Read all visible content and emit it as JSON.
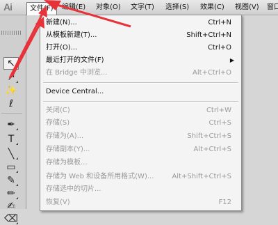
{
  "app": {
    "logo_text": "Ai"
  },
  "menubar": {
    "items": [
      "文件(F)",
      "编辑(E)",
      "对象(O)",
      "文字(T)",
      "选择(S)",
      "效果(C)",
      "视图(V)",
      "窗口"
    ]
  },
  "file_menu": {
    "items": [
      {
        "label": "新建(N)...",
        "shortcut": "Ctrl+N"
      },
      {
        "label": "从模板新建(T)...",
        "shortcut": "Shift+Ctrl+N"
      },
      {
        "label": "打开(O)...",
        "shortcut": "Ctrl+O"
      },
      {
        "label": "最近打开的文件(F)",
        "shortcut": ""
      },
      {
        "label": "在 Bridge 中浏览...",
        "shortcut": "Alt+Ctrl+O"
      },
      {
        "label": "Device Central...",
        "shortcut": ""
      },
      {
        "label": "关闭(C)",
        "shortcut": "Ctrl+W"
      },
      {
        "label": "存储(S)",
        "shortcut": "Ctrl+S"
      },
      {
        "label": "存储为(A)...",
        "shortcut": "Shift+Ctrl+S"
      },
      {
        "label": "存储副本(Y)...",
        "shortcut": "Alt+Ctrl+S"
      },
      {
        "label": "存储为模板...",
        "shortcut": ""
      },
      {
        "label": "存储为 Web 和设备所用格式(W)...",
        "shortcut": "Alt+Shift+Ctrl+S"
      },
      {
        "label": "存储选中的切片...",
        "shortcut": ""
      },
      {
        "label": "恢复(V)",
        "shortcut": "F12"
      }
    ]
  },
  "colors": {
    "annotation_arrow": "#e8323a",
    "menu_bg": "#f4f4f4",
    "disabled_text": "#9a9a9a"
  },
  "toolbox": {
    "tools": [
      "selection-tool",
      "direct-selection-tool",
      "magic-wand-tool",
      "lasso-tool",
      "pen-tool",
      "type-tool",
      "line-segment-tool",
      "rectangle-tool",
      "paintbrush-tool",
      "pencil-tool",
      "blob-brush-tool",
      "eraser-tool"
    ]
  }
}
